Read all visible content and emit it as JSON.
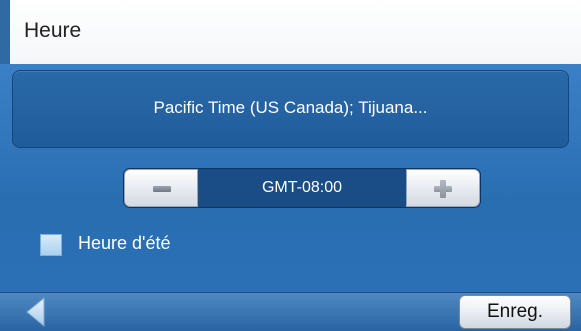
{
  "header": {
    "title": "Heure"
  },
  "timezone": {
    "name": "Pacific Time (US  Canada); Tijuana..."
  },
  "gmt_stepper": {
    "value": "GMT-08:00",
    "minus_icon": "minus-icon",
    "plus_icon": "plus-icon"
  },
  "dst": {
    "label": "Heure d'été",
    "checked": false
  },
  "footer": {
    "back_icon": "back-arrow-icon",
    "save_label": "Enreg."
  },
  "colors": {
    "accent": "#2f6aa3",
    "panel": "#1f5c9c",
    "body": "#2a6eb2"
  }
}
